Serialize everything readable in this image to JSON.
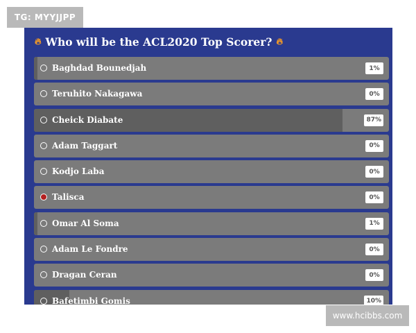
{
  "watermarks": {
    "top": "TG: MYYJJPP",
    "bottom": "www.hcibbs.com"
  },
  "poll": {
    "title": "Who will be the ACL2020 Top Scorer?",
    "title_icon": "fire-icon",
    "colors": {
      "panel": "#2a3a8f",
      "option": "#7b7b7b",
      "fill": "#5f5f5f",
      "selected_radio": "#b32020"
    },
    "options": [
      {
        "name": "Baghdad Bounedjah",
        "percent": "1%",
        "value": 1,
        "selected": false
      },
      {
        "name": "Teruhito Nakagawa",
        "percent": "0%",
        "value": 0,
        "selected": false
      },
      {
        "name": "Cheick Diabate",
        "percent": "87%",
        "value": 87,
        "selected": false
      },
      {
        "name": "Adam Taggart",
        "percent": "0%",
        "value": 0,
        "selected": false
      },
      {
        "name": "Kodjo Laba",
        "percent": "0%",
        "value": 0,
        "selected": false
      },
      {
        "name": "Talisca",
        "percent": "0%",
        "value": 0,
        "selected": true
      },
      {
        "name": "Omar Al Soma",
        "percent": "1%",
        "value": 1,
        "selected": false
      },
      {
        "name": "Adam Le Fondre",
        "percent": "0%",
        "value": 0,
        "selected": false
      },
      {
        "name": "Dragan Ceran",
        "percent": "0%",
        "value": 0,
        "selected": false
      },
      {
        "name": "Bafetimbi Gomis",
        "percent": "10%",
        "value": 10,
        "selected": false
      }
    ]
  }
}
